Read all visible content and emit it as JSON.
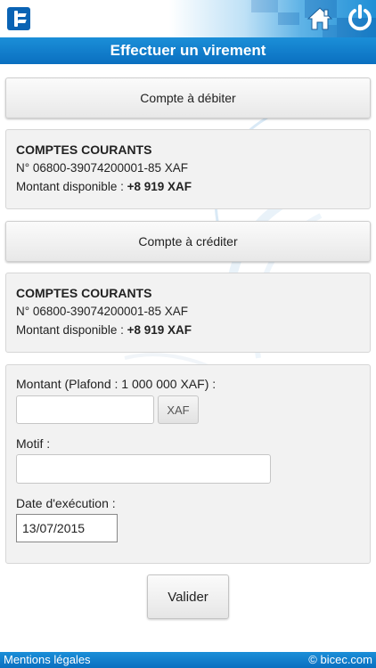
{
  "header": {
    "logo_icon": "bicec-logo-icon",
    "home_icon": "home-icon",
    "power_icon": "power-icon",
    "title": "Effectuer un virement"
  },
  "debit": {
    "button_label": "Compte à débiter",
    "account_type": "COMPTES COURANTS",
    "account_number": "N° 06800-39074200001-85 XAF",
    "available_label": "Montant disponible : ",
    "available_value": "+8 919 XAF"
  },
  "credit": {
    "button_label": "Compte à créditer",
    "account_type": "COMPTES COURANTS",
    "account_number": "N° 06800-39074200001-85 XAF",
    "available_label": "Montant disponible : ",
    "available_value": "+8 919 XAF"
  },
  "form": {
    "amount_label": "Montant (Plafond : 1 000 000 XAF) :",
    "amount_value": "",
    "currency": "XAF",
    "motif_label": "Motif :",
    "motif_value": "",
    "date_label": "Date d'exécution :",
    "date_value": "13/07/2015"
  },
  "submit_label": "Valider",
  "footer": {
    "legal": "Mentions légales",
    "copyright": "© bicec.com"
  },
  "colors": {
    "brand_blue": "#0a6fc0",
    "title_blue": "#1b8fd8"
  }
}
